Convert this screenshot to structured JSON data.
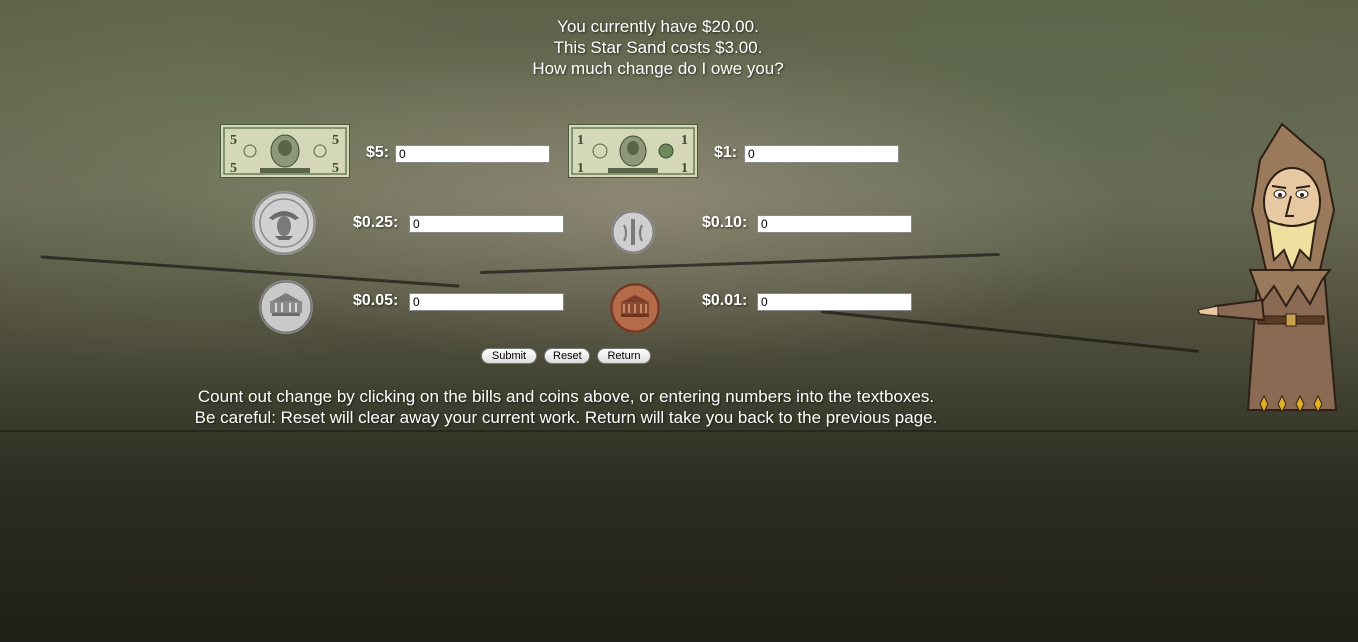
{
  "prompt": {
    "line1": "You currently have $20.00.",
    "line2": "This Star Sand costs $3.00.",
    "line3": "How much change do I owe you?"
  },
  "denominations": [
    {
      "label": "$5:",
      "value": "0",
      "icon": "five-dollar-bill-icon"
    },
    {
      "label": "$1:",
      "value": "0",
      "icon": "one-dollar-bill-icon"
    },
    {
      "label": "$0.25:",
      "value": "0",
      "icon": "quarter-coin-icon"
    },
    {
      "label": "$0.10:",
      "value": "0",
      "icon": "dime-coin-icon"
    },
    {
      "label": "$0.05:",
      "value": "0",
      "icon": "nickel-coin-icon"
    },
    {
      "label": "$0.01:",
      "value": "0",
      "icon": "penny-coin-icon"
    }
  ],
  "buttons": {
    "submit": "Submit",
    "reset": "Reset",
    "return": "Return"
  },
  "instructions": {
    "line1": "Count out change by clicking on the bills and coins above, or entering numbers into the textboxes.",
    "line2": "Be careful: Reset will clear away your current work. Return will take you back to the previous page."
  },
  "colors": {
    "bill_green": "#c9cfa8",
    "coin_silver": "#c8c8c8",
    "coin_copper": "#b36b4a"
  }
}
